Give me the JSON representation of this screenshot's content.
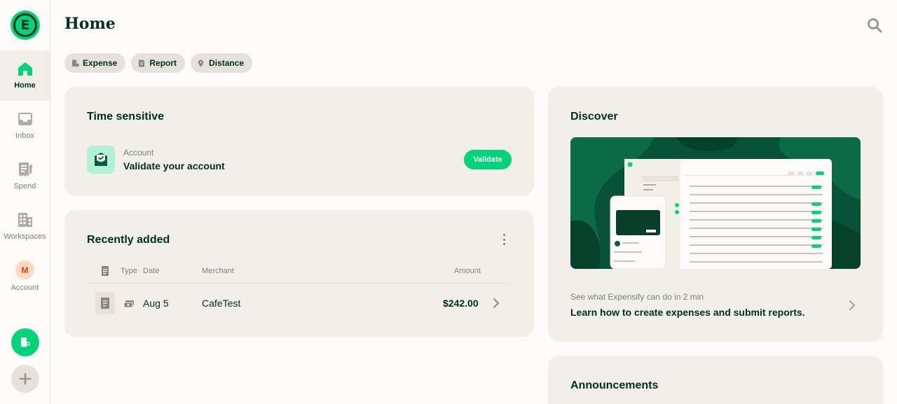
{
  "app": {
    "brand_letter": "E"
  },
  "nav": [
    {
      "label": "Home",
      "icon": "home-icon",
      "active": true
    },
    {
      "label": "Inbox",
      "icon": "inbox-icon",
      "active": false
    },
    {
      "label": "Spend",
      "icon": "receipt-icon",
      "active": false
    },
    {
      "label": "Workspaces",
      "icon": "building-icon",
      "active": false
    },
    {
      "label": "Account",
      "icon": "avatar",
      "active": false,
      "avatar_initial": "M"
    }
  ],
  "header": {
    "title": "Home"
  },
  "quick_actions": [
    {
      "label": "Expense",
      "icon": "expense-icon"
    },
    {
      "label": "Report",
      "icon": "report-icon"
    },
    {
      "label": "Distance",
      "icon": "distance-icon"
    }
  ],
  "time_sensitive": {
    "title": "Time sensitive",
    "item_category": "Account",
    "item_text": "Validate your account",
    "action_label": "Validate"
  },
  "recently_added": {
    "title": "Recently added",
    "columns": {
      "type": "Type",
      "date": "Date",
      "merchant": "Merchant",
      "amount": "Amount"
    },
    "rows": [
      {
        "date": "Aug 5",
        "merchant": "CafeTest",
        "amount": "$242.00",
        "type_icon": "cash-icon"
      }
    ]
  },
  "discover": {
    "title": "Discover",
    "subtitle": "See what Expensify can do in 2 min",
    "headline": "Learn how to create expenses and submit reports."
  },
  "announcements": {
    "title": "Announcements"
  },
  "colors": {
    "accent": "#03d47c",
    "dark_text": "#002e22",
    "muted_text": "#76847e",
    "card_bg": "#f2eee8",
    "page_bg": "#fcfbf9"
  }
}
